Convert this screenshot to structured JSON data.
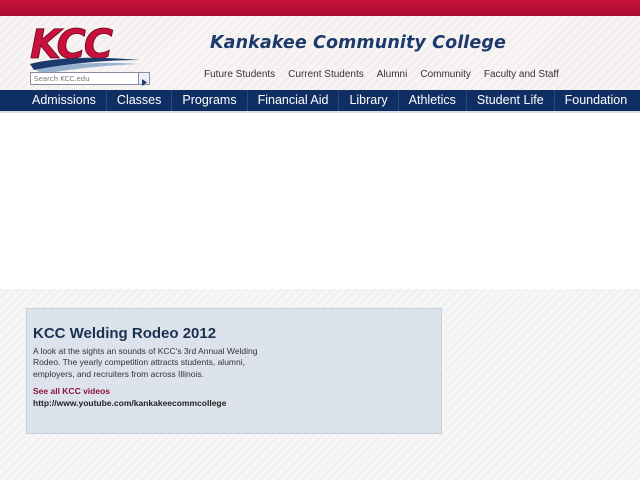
{
  "header": {
    "logo_text": "KCC",
    "college_name": "Kankakee Community College",
    "search_placeholder": "Search KCC.edu",
    "search_icon": "arrow-right-icon"
  },
  "utility_nav": [
    "Future Students",
    "Current Students",
    "Alumni",
    "Community",
    "Faculty and Staff"
  ],
  "main_nav": [
    "Admissions",
    "Classes",
    "Programs",
    "Financial Aid",
    "Library",
    "Athletics",
    "Student Life",
    "Foundation"
  ],
  "feature": {
    "title": "KCC Welding Rodeo 2012",
    "description": "A look at the sights an sounds of KCC's 3rd Annual Welding Rodeo. The yearly competition attracts students, alumni, employers, and recruiters from across Illinois.",
    "videos_link": "See all KCC videos",
    "youtube_url": "http://www.youtube.com/kankakeecommcollege"
  },
  "colors": {
    "brand_red": "#c8103a",
    "brand_navy": "#0f2f62",
    "panel_bg": "#dde3ec"
  }
}
